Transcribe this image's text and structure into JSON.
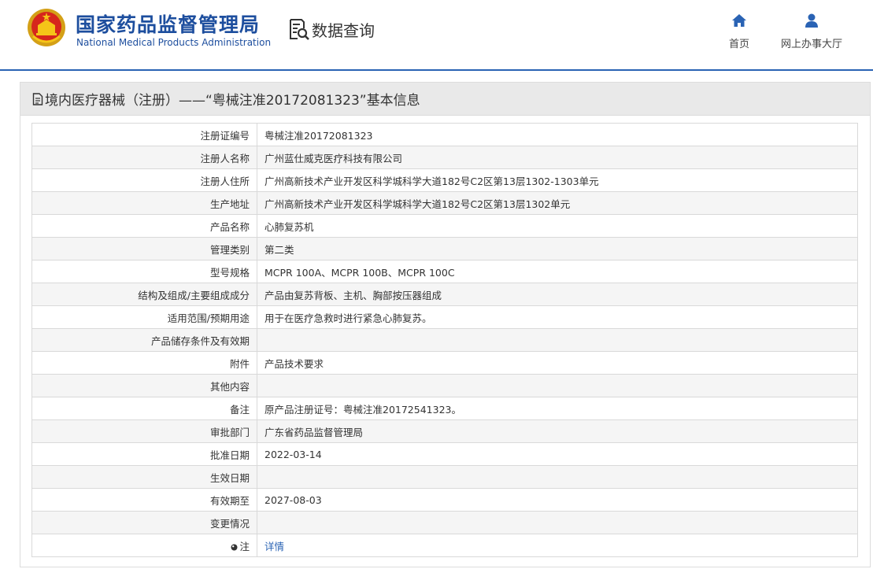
{
  "header": {
    "agency_name_cn": "国家药品监督管理局",
    "agency_name_en": "National Medical Products Administration",
    "data_query_label": "数据查询",
    "nav": [
      {
        "label": "首页",
        "icon": "home-icon"
      },
      {
        "label": "网上办事大厅",
        "icon": "user-icon"
      }
    ]
  },
  "panel": {
    "title": "境内医疗器械（注册）——“粤械注准20172081323”基本信息"
  },
  "rows": [
    {
      "label": "注册证编号",
      "value": "粤械注准20172081323"
    },
    {
      "label": "注册人名称",
      "value": "广州蓝仕威克医疗科技有限公司"
    },
    {
      "label": "注册人住所",
      "value": "广州高新技术产业开发区科学城科学大道182号C2区第13层1302-1303单元"
    },
    {
      "label": "生产地址",
      "value": "广州高新技术产业开发区科学城科学大道182号C2区第13层1302单元"
    },
    {
      "label": "产品名称",
      "value": "心肺复苏机"
    },
    {
      "label": "管理类别",
      "value": "第二类"
    },
    {
      "label": "型号规格",
      "value": "MCPR 100A、MCPR 100B、MCPR 100C"
    },
    {
      "label": "结构及组成/主要组成成分",
      "value": "产品由复苏背板、主机、胸部按压器组成"
    },
    {
      "label": "适用范围/预期用途",
      "value": "用于在医疗急救时进行紧急心肺复苏。"
    },
    {
      "label": "产品储存条件及有效期",
      "value": ""
    },
    {
      "label": "附件",
      "value": "产品技术要求"
    },
    {
      "label": "其他内容",
      "value": ""
    },
    {
      "label": "备注",
      "value": "原产品注册证号：粤械注准20172541323。"
    },
    {
      "label": "审批部门",
      "value": "广东省药品监督管理局"
    },
    {
      "label": "批准日期",
      "value": "2022-03-14"
    },
    {
      "label": "生效日期",
      "value": ""
    },
    {
      "label": "有效期至",
      "value": "2027-08-03"
    },
    {
      "label": "变更情况",
      "value": ""
    }
  ],
  "remark_row": {
    "label": "注",
    "link": "详情"
  },
  "colors": {
    "brand_blue": "#1d4e9e",
    "link_blue": "#2a63b4",
    "header_rule": "#2a63b4",
    "title_bar": "#e9e9e9"
  }
}
